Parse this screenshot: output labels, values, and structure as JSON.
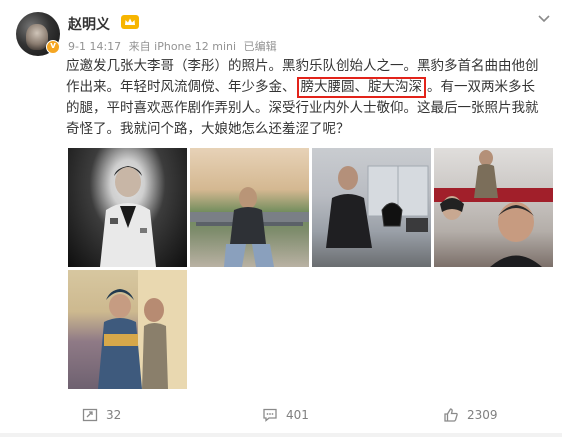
{
  "post": {
    "username": "赵明义",
    "verified_badge": "v",
    "meta": {
      "date": "9-1 14:17",
      "source": "来自 iPhone 12 mini",
      "edited": "已编辑"
    },
    "content": {
      "part1": "应邀发几张大李哥（李彤）的照片。黑豹乐队创始人之一。黑豹多首名曲由他创作出来。年轻时风流倜傥、年少多金、",
      "highlight": "膀大腰圆、腚大沟深",
      "part2": "。有一双两米多长的腿，平时喜欢恶作剧作弄别人。深受行业内外人士敬仰。这最后一张照片我就奇怪了。我就问个路，大娘她怎么还羞涩了呢？"
    },
    "photos": [
      "photo-1",
      "photo-2",
      "photo-3",
      "photo-4",
      "photo-5"
    ]
  },
  "actions": {
    "repost_count": "32",
    "comment_count": "401",
    "like_count": "2309"
  },
  "colors": {
    "highlight_border": "#e2231a",
    "meta_text": "#939393",
    "crown": "#f7b500"
  },
  "icons": [
    "crown-icon",
    "chevron-down-icon",
    "repost-icon",
    "comment-icon",
    "like-icon"
  ]
}
